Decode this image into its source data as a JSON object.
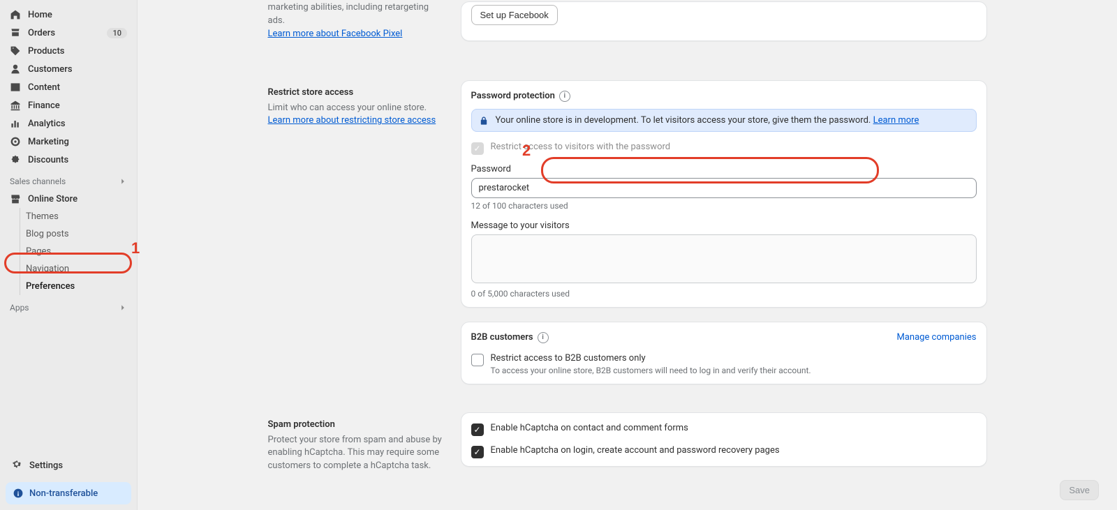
{
  "sidebar": {
    "items": [
      {
        "label": "Home"
      },
      {
        "label": "Orders",
        "badge": "10"
      },
      {
        "label": "Products"
      },
      {
        "label": "Customers"
      },
      {
        "label": "Content"
      },
      {
        "label": "Finance"
      },
      {
        "label": "Analytics"
      },
      {
        "label": "Marketing"
      },
      {
        "label": "Discounts"
      }
    ],
    "sales_channels_label": "Sales channels",
    "online_store": {
      "label": "Online Store",
      "subs": [
        {
          "label": "Themes"
        },
        {
          "label": "Blog posts"
        },
        {
          "label": "Pages"
        },
        {
          "label": "Navigation"
        },
        {
          "label": "Preferences"
        }
      ]
    },
    "apps_label": "Apps",
    "settings_label": "Settings",
    "plan_pill": "Non-transferable"
  },
  "facebook": {
    "desc": "marketing abilities, including retargeting ads.",
    "learn": "Learn more about Facebook Pixel",
    "setup_btn": "Set up Facebook"
  },
  "restrict": {
    "heading": "Restrict store access",
    "desc_pre": "Limit who can access your online store. ",
    "desc_link": "Learn more about restricting store access"
  },
  "password_card": {
    "title": "Password protection",
    "banner_text": "Your online store is in development. To let visitors access your store, give them the password. ",
    "banner_link": "Learn more",
    "restrict_label": "Restrict access to visitors with the password",
    "password_label": "Password",
    "password_value": "prestarocket",
    "password_hint": "12 of 100 characters used",
    "message_label": "Message to your visitors",
    "message_value": "",
    "message_hint": "0 of 5,000 characters used"
  },
  "b2b": {
    "title": "B2B customers",
    "manage_link": "Manage companies",
    "restrict_label": "Restrict access to B2B customers only",
    "restrict_sub": "To access your online store, B2B customers will need to log in and verify their account."
  },
  "spam": {
    "heading": "Spam protection",
    "desc": "Protect your store from spam and abuse by enabling hCaptcha. This may require some customers to complete a hCaptcha task.",
    "opt1": "Enable hCaptcha on contact and comment forms",
    "opt2": "Enable hCaptcha on login, create account and password recovery pages"
  },
  "save_label": "Save",
  "annotations": {
    "one": "1",
    "two": "2"
  }
}
